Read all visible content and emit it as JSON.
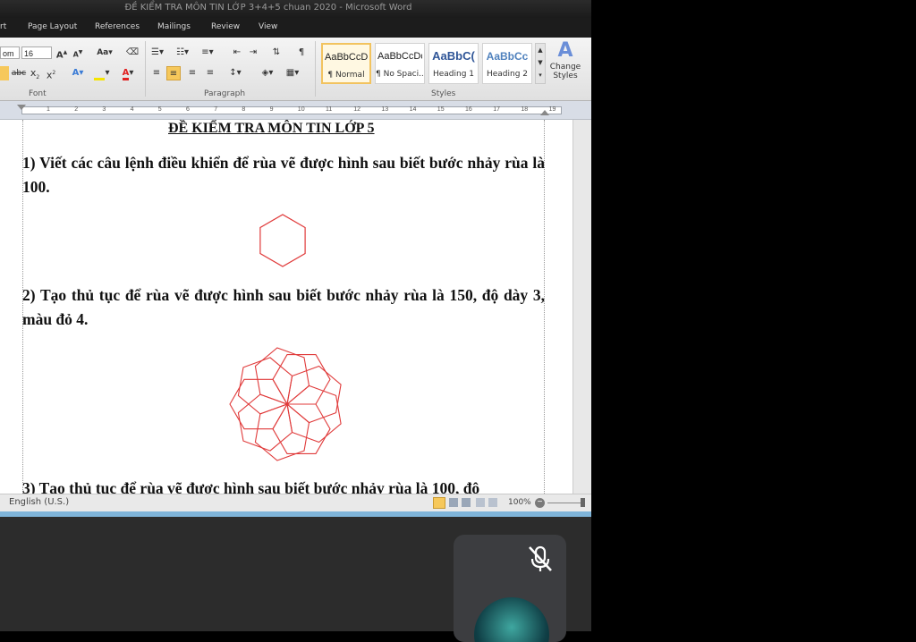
{
  "window": {
    "title": "ĐỀ KIỂM TRA MÔN TIN LỚP 3+4+5 chuan 2020 - Microsoft Word"
  },
  "ribbon_tabs": [
    "rt",
    "Page Layout",
    "References",
    "Mailings",
    "Review",
    "View"
  ],
  "ribbon": {
    "font_name": "om",
    "font_size": "16",
    "groups": {
      "font": "Font",
      "paragraph": "Paragraph",
      "styles": "Styles"
    },
    "styles": [
      {
        "sample": "AaBbCcDc",
        "name": "¶ Normal",
        "selected": true
      },
      {
        "sample": "AaBbCcDc",
        "name": "¶ No Spaci...",
        "selected": false
      },
      {
        "sample": "AaBbC(",
        "name": "Heading 1",
        "selected": false
      },
      {
        "sample": "AaBbCc",
        "name": "Heading 2",
        "selected": false
      }
    ],
    "change_styles": "Change Styles",
    "accent_font_color": "#e02020",
    "highlight_color": "#f5e400"
  },
  "ruler_numbers": [
    "1",
    "2",
    "3",
    "4",
    "5",
    "6",
    "7",
    "8",
    "9",
    "10",
    "11",
    "12",
    "13",
    "14",
    "15",
    "16",
    "17",
    "18",
    "19"
  ],
  "document": {
    "title": "ĐỀ KIỂM TRA MÔN TIN LỚP 5",
    "q1": "1) Viết các câu lệnh điều khiển để rùa vẽ được hình sau biết bước nhảy rùa là 100.",
    "q2": "2) Tạo thủ tục để rùa vẽ được hình sau biết bước nhảy rùa là 150, độ dày 3, màu đỏ 4.",
    "q3": "3) Tạo thủ tục để rùa vẽ được hình sau biết bước nhảy rùa là 100, độ",
    "figure_color": "#e03a3a"
  },
  "statusbar": {
    "language": "English (U.S.)",
    "zoom": "100%"
  },
  "meeting": {
    "mic_state": "muted",
    "icons": [
      "mic-off-icon",
      "avatar"
    ]
  }
}
